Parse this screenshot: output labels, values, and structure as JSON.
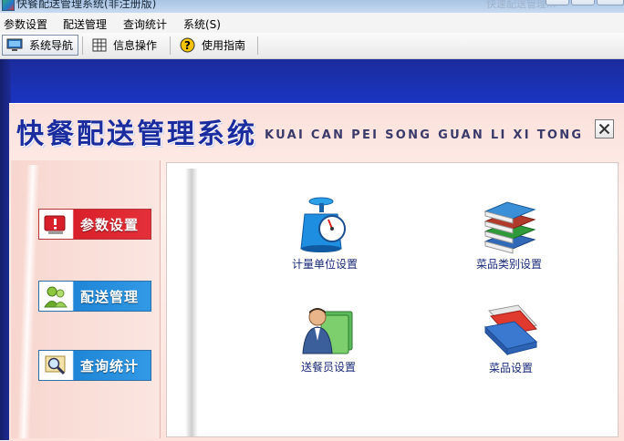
{
  "window": {
    "title": "快餐配送管理系统(非注册版)",
    "background_label": "快速配送管理..."
  },
  "menu": [
    "参数设置",
    "配送管理",
    "查询统计",
    "系统(S)"
  ],
  "toolbar": [
    {
      "label": "系统导航",
      "icon": "monitor-icon",
      "active": true
    },
    {
      "label": "信息操作",
      "icon": "grid-icon",
      "active": false
    },
    {
      "label": "使用指南",
      "icon": "help-icon",
      "active": false
    }
  ],
  "panel": {
    "title": "快餐配送管理系统",
    "subtitle": "KUAI CAN PEI SONG GUAN LI XI TONG"
  },
  "nav": [
    {
      "label": "参数设置",
      "color": "#d8202a"
    },
    {
      "label": "配送管理",
      "color": "#1f86d7"
    },
    {
      "label": "查询统计",
      "color": "#1f86d7"
    }
  ],
  "tiles": [
    {
      "label": "计量单位设置",
      "icon": "scale-icon"
    },
    {
      "label": "菜品类别设置",
      "icon": "books-icon"
    },
    {
      "label": "送餐员设置",
      "icon": "person-icon"
    },
    {
      "label": "菜品设置",
      "icon": "folder-icon"
    }
  ]
}
